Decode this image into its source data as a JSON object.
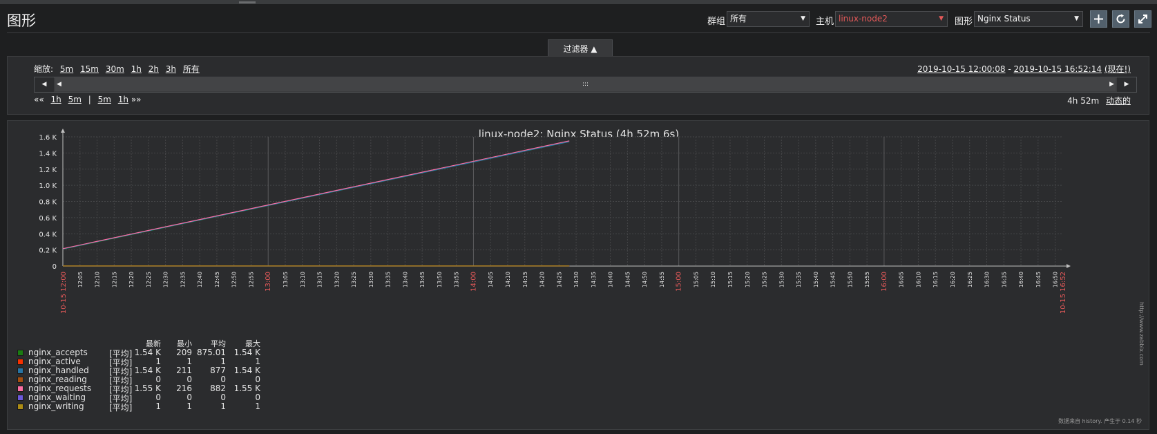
{
  "page": {
    "title": "图形"
  },
  "controls": {
    "group_label": "群组",
    "group_value": "所有",
    "host_label": "主机",
    "host_value": "linux-node2",
    "graph_label": "图形",
    "graph_value": "Nginx Status"
  },
  "filter": {
    "tab_label": "过滤器 ▲",
    "zoom_label": "缩放:",
    "zoom_options": [
      "5m",
      "15m",
      "30m",
      "1h",
      "2h",
      "3h",
      "所有"
    ],
    "time_from": "2019-10-15 12:00:08",
    "time_sep": " - ",
    "time_to": "2019-10-15 16:52:14",
    "now_label": "(现在!)",
    "nav_left": [
      "«« ",
      "1h",
      "5m"
    ],
    "nav_sep": "|",
    "nav_right": [
      "5m",
      "1h",
      " »»"
    ],
    "period": "4h 52m",
    "dynamic_label": "动态的",
    "drag_marker": ":::",
    "progress": 1.0
  },
  "graph": {
    "title": "linux-node2: Nginx Status (4h 52m 6s)",
    "footer": "数据来自 history. 产生于 0.14 秒",
    "url": "http://www.zabbix.com"
  },
  "legend": {
    "headers": {
      "last": "最新",
      "min": "最小",
      "avg": "平均",
      "max": "最大"
    },
    "items": [
      {
        "name": "nginx_accepts",
        "agg": "[平均]",
        "last": "1.54 K",
        "min": "209",
        "avg": "875.01",
        "max": "1.54 K",
        "color": "#1a7c11"
      },
      {
        "name": "nginx_active",
        "agg": "[平均]",
        "last": "1",
        "min": "1",
        "avg": "1",
        "max": "1",
        "color": "#f63100"
      },
      {
        "name": "nginx_handled",
        "agg": "[平均]",
        "last": "1.54 K",
        "min": "211",
        "avg": "877",
        "max": "1.54 K",
        "color": "#2774a4"
      },
      {
        "name": "nginx_reading",
        "agg": "[平均]",
        "last": "0",
        "min": "0",
        "avg": "0",
        "max": "0",
        "color": "#a54f10"
      },
      {
        "name": "nginx_requests",
        "agg": "[平均]",
        "last": "1.55 K",
        "min": "216",
        "avg": "882",
        "max": "1.55 K",
        "color": "#fc6ea3"
      },
      {
        "name": "nginx_waiting",
        "agg": "[平均]",
        "last": "0",
        "min": "0",
        "avg": "0",
        "max": "0",
        "color": "#6c59dc"
      },
      {
        "name": "nginx_writing",
        "agg": "[平均]",
        "last": "1",
        "min": "1",
        "avg": "1",
        "max": "1",
        "color": "#ac8c14"
      }
    ]
  },
  "chart_data": {
    "type": "line",
    "title": "linux-node2: Nginx Status (4h 52m 6s)",
    "xlabel": "",
    "ylabel": "",
    "y_ticks": [
      "0",
      "0.2 K",
      "0.4 K",
      "0.6 K",
      "0.8 K",
      "1.0 K",
      "1.2 K",
      "1.4 K",
      "1.6 K"
    ],
    "ylim": [
      0,
      1600
    ],
    "x_start_label": "10-15 12:00",
    "x_end_label": "10-15 16:52",
    "x_ticks": [
      "12:05",
      "12:10",
      "12:15",
      "12:20",
      "12:25",
      "12:30",
      "12:35",
      "12:40",
      "12:45",
      "12:50",
      "12:55",
      "13:00",
      "13:05",
      "13:10",
      "13:15",
      "13:20",
      "13:25",
      "13:30",
      "13:35",
      "13:40",
      "13:45",
      "13:50",
      "13:55",
      "14:00",
      "14:05",
      "14:10",
      "14:15",
      "14:20",
      "14:25",
      "14:30",
      "14:35",
      "14:40",
      "14:45",
      "14:50",
      "14:55",
      "15:00",
      "15:05",
      "15:10",
      "15:15",
      "15:20",
      "15:25",
      "15:30",
      "15:35",
      "15:40",
      "15:45",
      "15:50",
      "15:55",
      "16:00",
      "16:05",
      "16:10",
      "16:15",
      "16:20",
      "16:25",
      "16:30",
      "16:35",
      "16:40",
      "16:45",
      "16:50"
    ],
    "x_highlight": [
      "13:00",
      "14:00",
      "15:00",
      "16:00"
    ],
    "grid": true,
    "series": [
      {
        "name": "nginx_accepts",
        "color": "#1a7c11",
        "x": [
          "12:00",
          "14:28"
        ],
        "values": [
          209,
          1540
        ]
      },
      {
        "name": "nginx_handled",
        "color": "#2774a4",
        "x": [
          "12:00",
          "14:28"
        ],
        "values": [
          211,
          1540
        ]
      },
      {
        "name": "nginx_requests",
        "color": "#fc6ea3",
        "x": [
          "12:00",
          "14:28"
        ],
        "values": [
          216,
          1550
        ]
      },
      {
        "name": "nginx_active",
        "color": "#f63100",
        "x": [
          "12:00",
          "14:28"
        ],
        "values": [
          1,
          1
        ]
      },
      {
        "name": "nginx_reading",
        "color": "#a54f10",
        "x": [
          "12:00",
          "14:28"
        ],
        "values": [
          0,
          0
        ]
      },
      {
        "name": "nginx_waiting",
        "color": "#6c59dc",
        "x": [
          "12:00",
          "14:28"
        ],
        "values": [
          0,
          0
        ]
      },
      {
        "name": "nginx_writing",
        "color": "#ac8c14",
        "x": [
          "12:00",
          "14:28"
        ],
        "values": [
          1,
          1
        ]
      }
    ]
  }
}
